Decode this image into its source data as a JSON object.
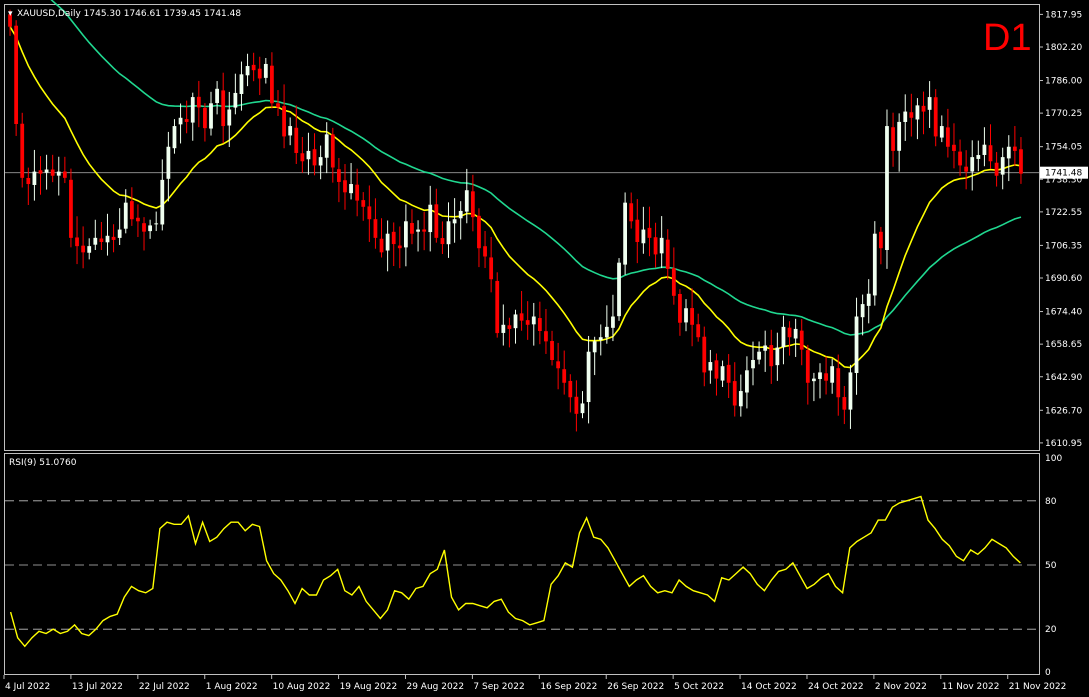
{
  "header": {
    "symbol_line": "XAUUSD,Daily  1745.30 1746.61 1739.45 1741.48",
    "timeframe_badge": "D1"
  },
  "rsi_panel": {
    "label": "RSI(9) 51.0760"
  },
  "colors": {
    "background": "#000000",
    "frame": "#c0c0c0",
    "bull_candle": "#f0fff0",
    "bear_candle": "#ff0000",
    "ma_fast": "#ffff00",
    "ma_slow": "#20d890",
    "rsi_line": "#ffff00",
    "grid_dash": "#c0c0c0",
    "badge": "#ff0000"
  },
  "chart_data": [
    {
      "type": "candlestick",
      "title": "XAUUSD,Daily",
      "price_axis_ticks": [
        "1817.95",
        "1802.20",
        "1786.00",
        "1770.25",
        "1754.05",
        "1738.30",
        "1722.55",
        "1706.35",
        "1690.60",
        "1674.40",
        "1658.65",
        "1642.90",
        "1626.70",
        "1610.95"
      ],
      "current_price": "1741.48",
      "ylim": [
        1608,
        1822
      ],
      "x_tick_labels": [
        "4 Jul 2022",
        "13 Jul 2022",
        "22 Jul 2022",
        "1 Aug 2022",
        "10 Aug 2022",
        "19 Aug 2022",
        "29 Aug 2022",
        "7 Sep 2022",
        "16 Sep 2022",
        "26 Sep 2022",
        "5 Oct 2022",
        "14 Oct 2022",
        "24 Oct 2022",
        "2 Nov 2022",
        "11 Nov 2022",
        "21 Nov 2022"
      ],
      "close_estimates": [
        1812,
        1765,
        1739,
        1736,
        1742,
        1741,
        1743,
        1740,
        1742,
        1739,
        1710,
        1706,
        1703,
        1706,
        1710,
        1708,
        1711,
        1709,
        1714,
        1727,
        1719,
        1718,
        1713,
        1716,
        1717,
        1738,
        1754,
        1764,
        1768,
        1766,
        1778,
        1773,
        1763,
        1775,
        1782,
        1764,
        1772,
        1780,
        1789,
        1793,
        1791,
        1787,
        1794,
        1775,
        1773,
        1759,
        1764,
        1751,
        1747,
        1752,
        1745,
        1749,
        1760,
        1744,
        1737,
        1732,
        1736,
        1728,
        1725,
        1719,
        1710,
        1703,
        1712,
        1707,
        1705,
        1718,
        1712,
        1714,
        1713,
        1726,
        1710,
        1707,
        1718,
        1719,
        1723,
        1733,
        1720,
        1705,
        1701,
        1690,
        1664,
        1668,
        1666,
        1673,
        1670,
        1668,
        1672,
        1665,
        1660,
        1651,
        1647,
        1640,
        1633,
        1625,
        1630,
        1655,
        1660,
        1662,
        1667,
        1672,
        1698,
        1727,
        1718,
        1708,
        1714,
        1710,
        1702,
        1710,
        1695,
        1682,
        1669,
        1676,
        1668,
        1662,
        1645,
        1650,
        1642,
        1648,
        1640,
        1629,
        1636,
        1646,
        1651,
        1655,
        1658,
        1648,
        1657,
        1667,
        1662,
        1666,
        1656,
        1640,
        1642,
        1645,
        1641,
        1648,
        1633,
        1627,
        1645,
        1672,
        1678,
        1683,
        1712,
        1705,
        1764,
        1752,
        1766,
        1771,
        1768,
        1774,
        1771,
        1778,
        1759,
        1764,
        1754,
        1752,
        1745,
        1742,
        1749,
        1750,
        1755,
        1747,
        1740,
        1749,
        1754,
        1752,
        1741
      ]
    },
    {
      "type": "line",
      "title": "RSI(9) 51.0760",
      "ylim": [
        0,
        100
      ],
      "y_tick_labels": [
        "100",
        "80",
        "50",
        "20",
        "0"
      ],
      "levels": [
        80,
        50,
        20
      ],
      "values": [
        28,
        16,
        12,
        16,
        19,
        18,
        20,
        18,
        19,
        22,
        18,
        17,
        20,
        24,
        26,
        27,
        35,
        40,
        38,
        37,
        39,
        67,
        70,
        69,
        69,
        73,
        60,
        70,
        61,
        63,
        67,
        70,
        70,
        66,
        69,
        68,
        52,
        46,
        43,
        38,
        32,
        39,
        36,
        36,
        43,
        45,
        48,
        38,
        36,
        40,
        33,
        29,
        25,
        29,
        38,
        37,
        34,
        39,
        40,
        46,
        48,
        57,
        35,
        29,
        32,
        32,
        31,
        30,
        33,
        34,
        28,
        25,
        24,
        22,
        23,
        24,
        41,
        45,
        51,
        49,
        65,
        72,
        63,
        62,
        58,
        52,
        46,
        40,
        43,
        45,
        40,
        37,
        38,
        37,
        43,
        40,
        38,
        37,
        36,
        33,
        44,
        43,
        46,
        49,
        46,
        41,
        38,
        43,
        47,
        48,
        51,
        45,
        39,
        41,
        44,
        46,
        40,
        37,
        58,
        61,
        63,
        65,
        71,
        71,
        77,
        79,
        80,
        81,
        82,
        71,
        67,
        62,
        59,
        54,
        52,
        57,
        55,
        58,
        62,
        60,
        58,
        54,
        51
      ]
    }
  ]
}
